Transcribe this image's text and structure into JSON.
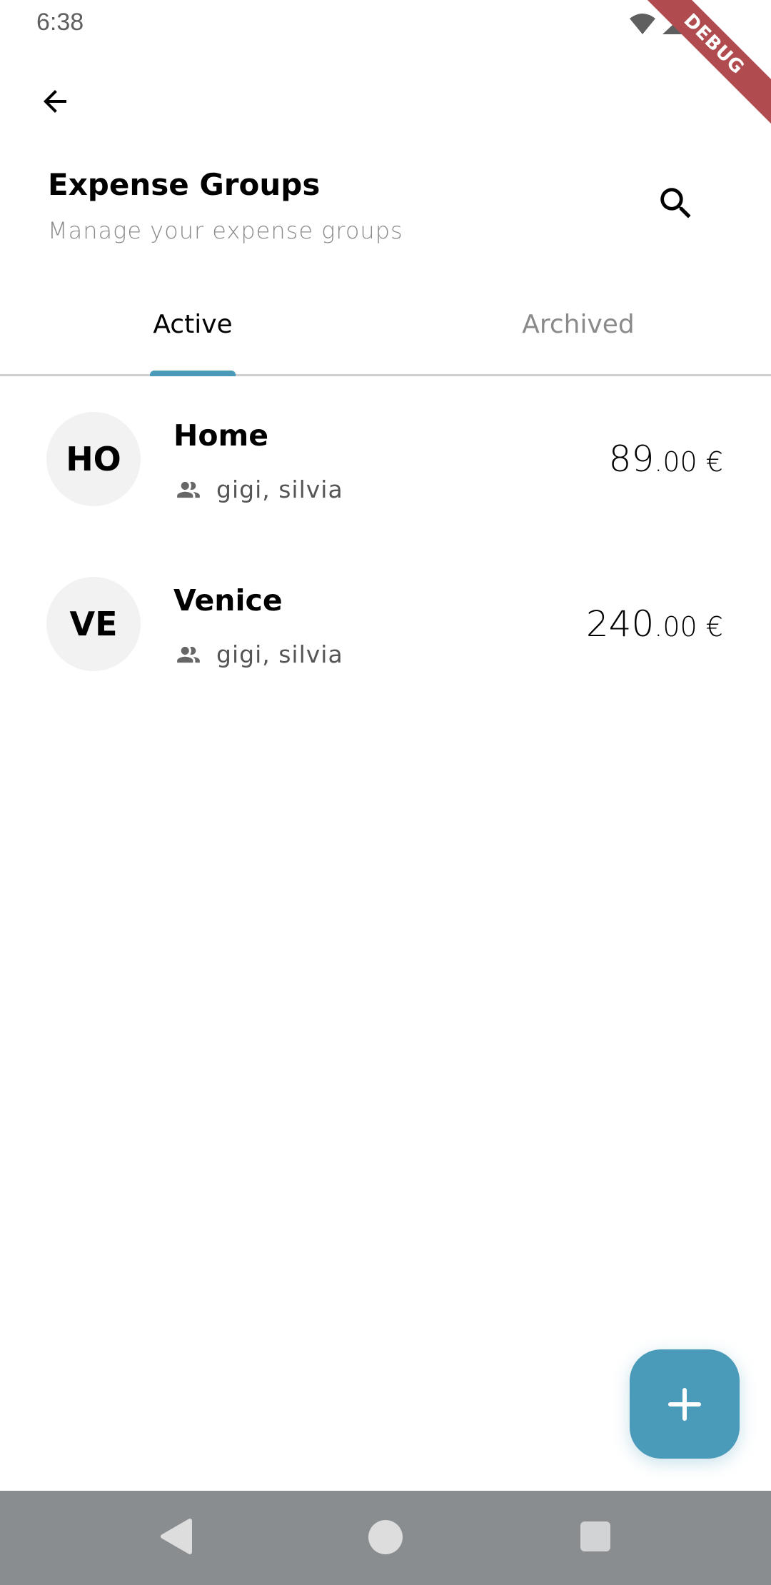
{
  "status_bar": {
    "time": "6:38",
    "icons": [
      "wifi-icon",
      "signal-icon"
    ]
  },
  "debug_banner": "DEBUG",
  "header": {
    "title": "Expense Groups",
    "subtitle": "Manage your expense groups",
    "back_icon": "arrow-left-icon",
    "search_icon": "search-icon"
  },
  "tabs": [
    {
      "label": "Active",
      "selected": true
    },
    {
      "label": "Archived",
      "selected": false
    }
  ],
  "groups": [
    {
      "initials": "HO",
      "name": "Home",
      "members": "gigi, silvia",
      "amount_int": "89",
      "amount_dec": ".00 €"
    },
    {
      "initials": "VE",
      "name": "Venice",
      "members": "gigi, silvia",
      "amount_int": "240",
      "amount_dec": ".00 €"
    }
  ],
  "fab": {
    "icon": "plus-icon"
  },
  "colors": {
    "accent": "#4a9aba",
    "avatar_bg": "#f2f2f2",
    "nav_bar": "#8a8d90"
  },
  "nav_bar": {
    "icons": [
      "back-icon",
      "home-icon",
      "recents-icon"
    ]
  }
}
